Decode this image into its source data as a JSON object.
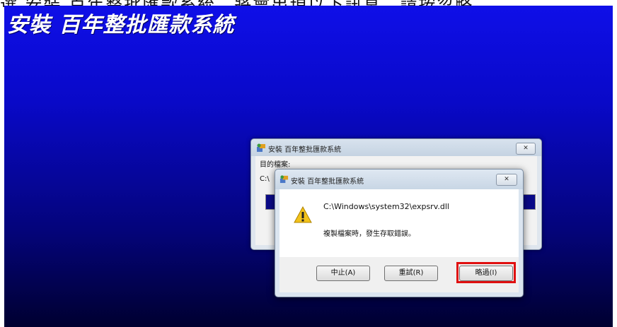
{
  "top_strip_text": "選 安裝 百年整批匯款系統，將會出現以下訊息，請按忽略",
  "installer": {
    "title": "安裝 百年整批匯款系統",
    "background_color": "#0909c8"
  },
  "progress_window": {
    "title": "安裝 百年整批匯款系統",
    "label": "目的檔案:",
    "path": "C:\\",
    "close_glyph": "✕",
    "progress_fraction": 1.0
  },
  "error_dialog": {
    "title": "安裝 百年整批匯款系統",
    "close_glyph": "✕",
    "path": "C:\\Windows\\system32\\expsrv.dll",
    "message": "複製檔案時，發生存取錯誤。",
    "buttons": {
      "abort": "中止(A)",
      "retry": "重試(R)",
      "ignore": "略過(I)"
    },
    "highlight_color": "#e01010"
  }
}
